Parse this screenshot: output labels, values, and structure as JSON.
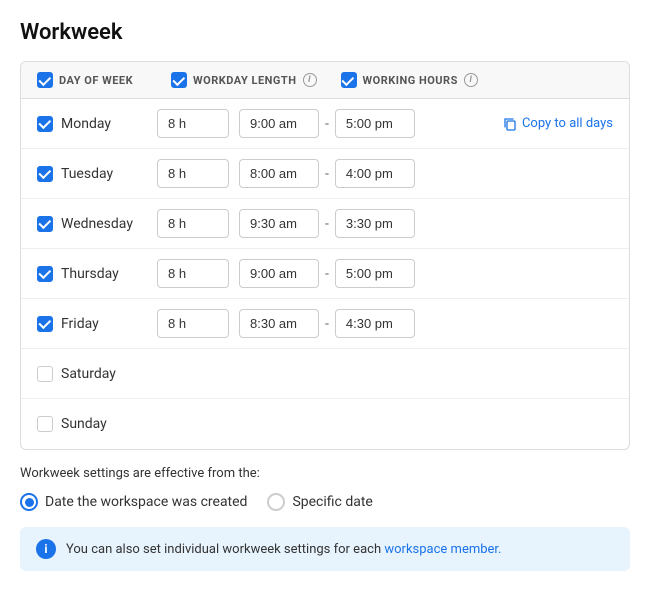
{
  "page": {
    "title": "Workweek"
  },
  "header": {
    "col1": "DAY OF WEEK",
    "col2": "WORKDAY LENGTH",
    "col3": "WORKING HOURS",
    "info_label": "i"
  },
  "days": [
    {
      "name": "Monday",
      "checked": true,
      "workday": "8 h",
      "start": "9:00 am",
      "end": "5:00 pm",
      "show_copy": true
    },
    {
      "name": "Tuesday",
      "checked": true,
      "workday": "8 h",
      "start": "8:00 am",
      "end": "4:00 pm",
      "show_copy": false
    },
    {
      "name": "Wednesday",
      "checked": true,
      "workday": "8 h",
      "start": "9:30 am",
      "end": "3:30 pm",
      "show_copy": false
    },
    {
      "name": "Thursday",
      "checked": true,
      "workday": "8 h",
      "start": "9:00 am",
      "end": "5:00 pm",
      "show_copy": false
    },
    {
      "name": "Friday",
      "checked": true,
      "workday": "8 h",
      "start": "8:30 am",
      "end": "4:30 pm",
      "show_copy": false
    },
    {
      "name": "Saturday",
      "checked": false,
      "workday": "",
      "start": "",
      "end": "",
      "show_copy": false
    },
    {
      "name": "Sunday",
      "checked": false,
      "workday": "",
      "start": "",
      "end": "",
      "show_copy": false
    }
  ],
  "settings": {
    "note": "Workweek settings are effective from the:",
    "option1": "Date the workspace was created",
    "option2": "Specific date",
    "selected": "option1"
  },
  "copy_button": "Copy to all days",
  "dash": "-",
  "banner": {
    "text": "You can also set individual workweek settings for each",
    "link_text": "workspace member.",
    "info": "i"
  }
}
